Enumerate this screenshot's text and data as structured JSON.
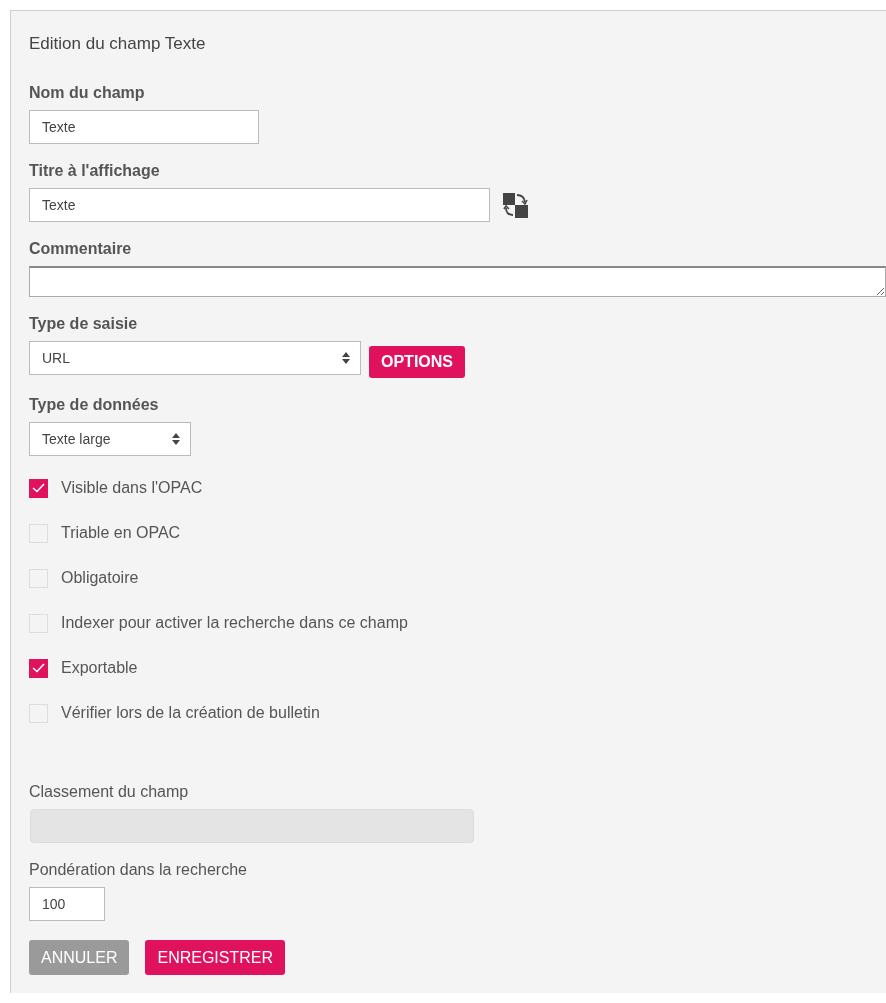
{
  "title": "Edition du champ Texte",
  "name_field": {
    "label": "Nom du champ",
    "value": "Texte"
  },
  "display_title": {
    "label": "Titre à l'affichage",
    "value": "Texte"
  },
  "comment": {
    "label": "Commentaire"
  },
  "input_type": {
    "label": "Type de saisie",
    "value": "URL",
    "button": "OPTIONS"
  },
  "data_type": {
    "label": "Type de données",
    "value": "Texte large"
  },
  "checkboxes": [
    {
      "label": "Visible dans l'OPAC",
      "checked": true
    },
    {
      "label": "Triable en OPAC",
      "checked": false
    },
    {
      "label": "Obligatoire",
      "checked": false
    },
    {
      "label": "Indexer pour activer la recherche dans ce champ",
      "checked": false
    },
    {
      "label": "Exportable",
      "checked": true
    },
    {
      "label": "Vérifier lors de la création de bulletin",
      "checked": false
    }
  ],
  "ranking": {
    "label": "Classement du champ",
    "disabled": true
  },
  "weighting": {
    "label": "Pondération dans la recherche",
    "value": "100"
  },
  "buttons": [
    {
      "label": "ANNULER",
      "kind": "secondary"
    },
    {
      "label": "ENREGISTRER",
      "kind": "primary"
    }
  ]
}
